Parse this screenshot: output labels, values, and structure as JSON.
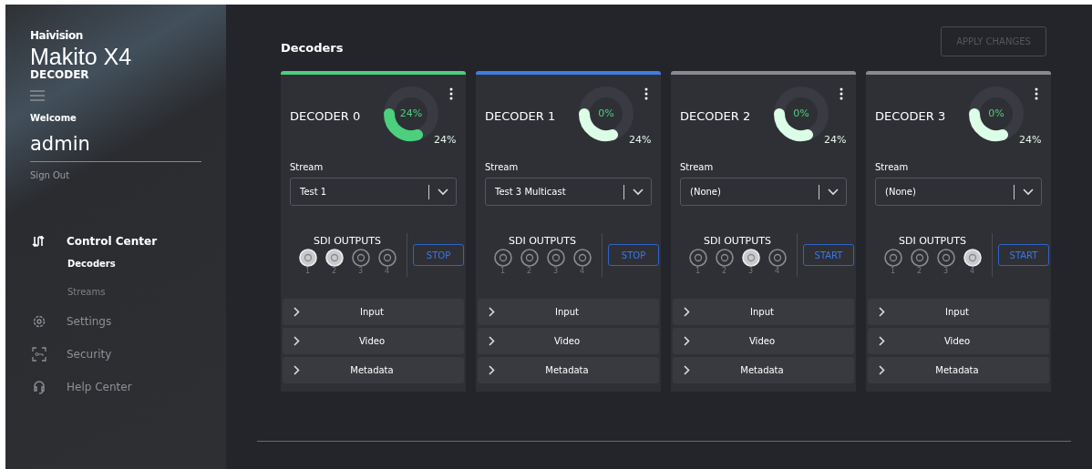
{
  "brand": {
    "company": "Haivision",
    "product": "Makito X4",
    "subtitle": "DECODER"
  },
  "user": {
    "greeting": "Welcome",
    "name": "admin",
    "sign_out": "Sign Out"
  },
  "nav": [
    {
      "label": "Control Center",
      "selected": true,
      "children": [
        {
          "label": "Decoders",
          "selected": true
        },
        {
          "label": "Streams",
          "selected": false
        }
      ]
    },
    {
      "label": "Settings",
      "selected": false
    },
    {
      "label": "Security",
      "selected": false
    },
    {
      "label": "Help Center",
      "selected": false
    }
  ],
  "page": {
    "title": "Decoders",
    "apply_button": {
      "label": "APPLY CHANGES",
      "disabled": true
    }
  },
  "decoders": [
    {
      "name": "DECODER 0",
      "color": "#4cd07d",
      "active": true,
      "gauge_center": "24%",
      "gauge_reading": "24%",
      "stream_label": "Stream",
      "stream": "Test 1",
      "sdi_title": "SDI OUTPUTS",
      "outputs": [
        {
          "label": "1",
          "on": true
        },
        {
          "label": "2",
          "on": true
        },
        {
          "label": "3",
          "on": false
        },
        {
          "label": "4",
          "on": false
        }
      ],
      "action": "STOP",
      "sections": [
        "Input",
        "Video",
        "Metadata"
      ]
    },
    {
      "name": "DECODER 1",
      "color": "#3d7fe0",
      "active": false,
      "gauge_center": "0%",
      "gauge_reading": "24%",
      "stream_label": "Stream",
      "stream": "Test 3 Multicast",
      "sdi_title": "SDI OUTPUTS",
      "outputs": [
        {
          "label": "1",
          "on": false
        },
        {
          "label": "2",
          "on": false
        },
        {
          "label": "3",
          "on": false
        },
        {
          "label": "4",
          "on": false
        }
      ],
      "action": "STOP",
      "sections": [
        "Input",
        "Video",
        "Metadata"
      ]
    },
    {
      "name": "DECODER 2",
      "color": "#8a8b90",
      "active": false,
      "gauge_center": "0%",
      "gauge_reading": "24%",
      "stream_label": "Stream",
      "stream": "(None)",
      "sdi_title": "SDI OUTPUTS",
      "outputs": [
        {
          "label": "1",
          "on": false
        },
        {
          "label": "2",
          "on": false
        },
        {
          "label": "3",
          "on": true
        },
        {
          "label": "4",
          "on": false
        }
      ],
      "action": "START",
      "sections": [
        "Input",
        "Video",
        "Metadata"
      ]
    },
    {
      "name": "DECODER 3",
      "color": "#8a8b90",
      "active": false,
      "gauge_center": "0%",
      "gauge_reading": "24%",
      "stream_label": "Stream",
      "stream": "(None)",
      "sdi_title": "SDI OUTPUTS",
      "outputs": [
        {
          "label": "1",
          "on": false
        },
        {
          "label": "2",
          "on": false
        },
        {
          "label": "3",
          "on": false
        },
        {
          "label": "4",
          "on": true
        }
      ],
      "action": "START",
      "sections": [
        "Input",
        "Video",
        "Metadata"
      ]
    }
  ]
}
